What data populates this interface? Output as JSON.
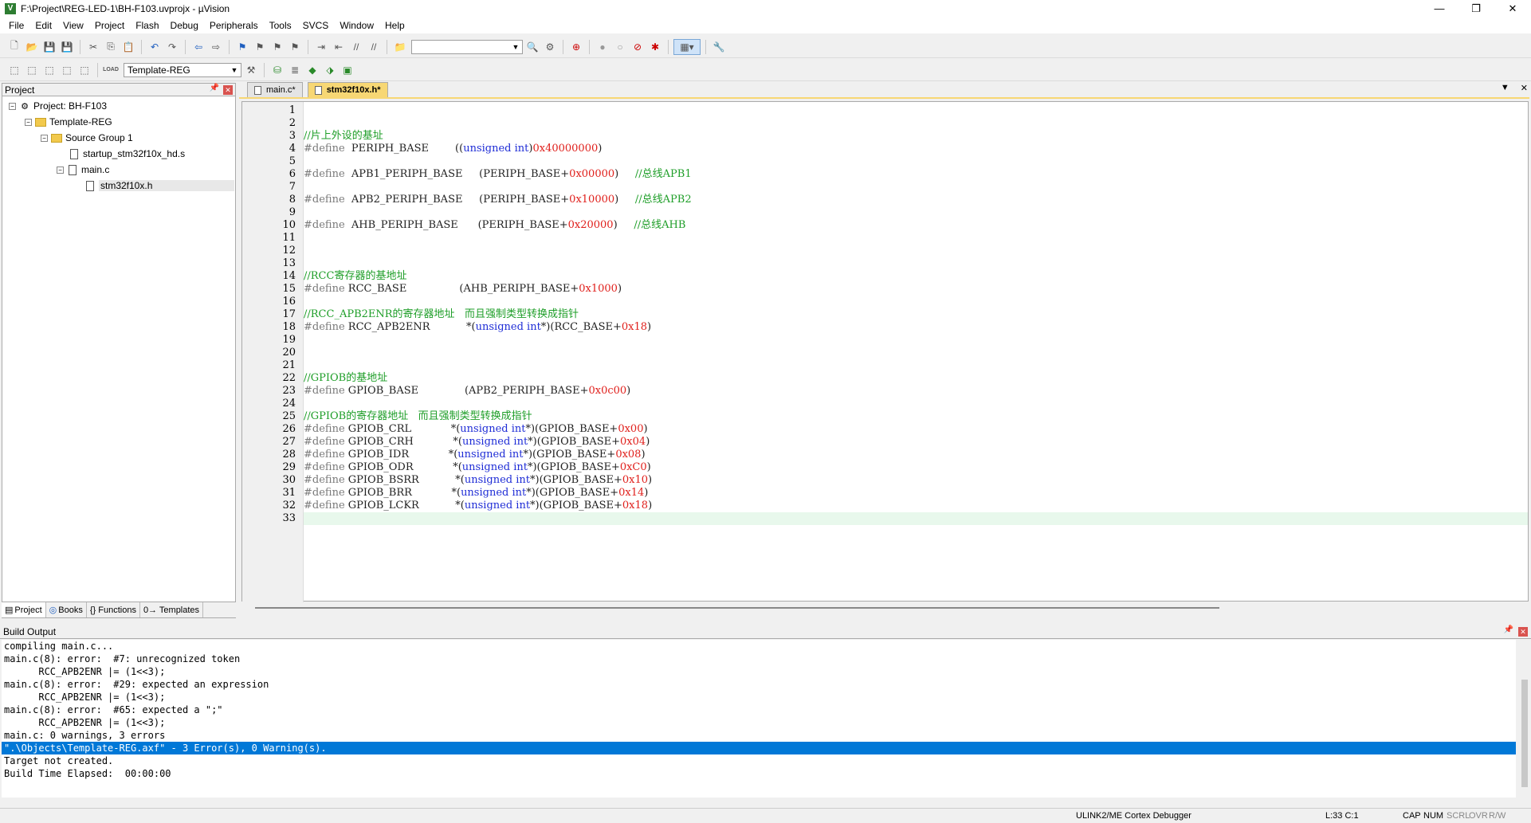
{
  "window": {
    "title": "F:\\Project\\REG-LED-1\\BH-F103.uvprojx - µVision",
    "app_icon": "uv-logo-icon",
    "controls": {
      "minimize": "—",
      "maximize": "❐",
      "close": "✕"
    }
  },
  "menu": [
    "File",
    "Edit",
    "View",
    "Project",
    "Flash",
    "Debug",
    "Peripherals",
    "Tools",
    "SVCS",
    "Window",
    "Help"
  ],
  "toolbar2": {
    "target": "Template-REG",
    "load_label": "LOAD"
  },
  "project_panel": {
    "title": "Project",
    "tree": [
      {
        "label": "Project: BH-F103",
        "icon": "project-icon"
      },
      {
        "label": "Template-REG",
        "icon": "target-folder-icon"
      },
      {
        "label": "Source Group 1",
        "icon": "folder-icon"
      },
      {
        "label": "startup_stm32f10x_hd.s",
        "icon": "file-icon"
      },
      {
        "label": "main.c",
        "icon": "file-icon"
      },
      {
        "label": "stm32f10x.h",
        "icon": "file-icon"
      }
    ],
    "tabs": [
      "Project",
      "Books",
      "{} Functions",
      "0→ Templates"
    ]
  },
  "editor": {
    "tabs": [
      "main.c*",
      "stm32f10x.h*"
    ],
    "active_tab": "stm32f10x.h*",
    "line_numbers": [
      "1",
      "2",
      "3",
      "4",
      "5",
      "6",
      "7",
      "8",
      "9",
      "10",
      "11",
      "12",
      "13",
      "14",
      "15",
      "16",
      "17",
      "18",
      "19",
      "20",
      "21",
      "22",
      "23",
      "24",
      "25",
      "26",
      "27",
      "28",
      "29",
      "30",
      "31",
      "32",
      "33"
    ],
    "cursor_line": 33
  },
  "build_output": {
    "title": "Build Output",
    "lines": [
      "compiling main.c...",
      "main.c(8): error:  #7: unrecognized token",
      "      RCC_APB2ENR |= (1<<3);",
      "main.c(8): error:  #29: expected an expression",
      "      RCC_APB2ENR |= (1<<3);",
      "main.c(8): error:  #65: expected a \";\"",
      "      RCC_APB2ENR |= (1<<3);",
      "main.c: 0 warnings, 3 errors",
      "\".\\Objects\\Template-REG.axf\" - 3 Error(s), 0 Warning(s).",
      "Target not created.",
      "Build Time Elapsed:  00:00:00"
    ],
    "highlighted_line": 8
  },
  "status_bar": {
    "debugger": "ULINK2/ME Cortex Debugger",
    "position": "L:33 C:1",
    "cap": "CAP",
    "num": "NUM",
    "scrl": "SCRL",
    "ovr": "OVR",
    "rw": "R/W"
  },
  "colors": {
    "comment": "#1e9e28",
    "number": "#e0201c",
    "keyword": "#1f2dd6",
    "preprocessor": "#7a7a7a",
    "selection": "#0078d7",
    "active_tab": "#f7d774"
  }
}
